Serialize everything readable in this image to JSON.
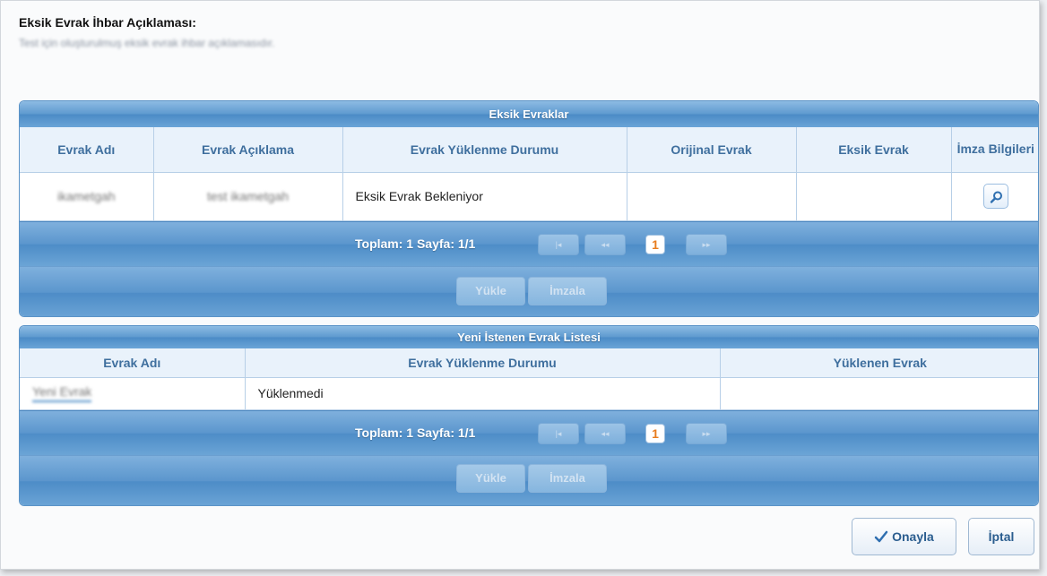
{
  "description": {
    "title": "Eksik Evrak İhbar Açıklaması:",
    "text": "Test için oluşturulmuş eksik evrak ihbar açıklamasıdır."
  },
  "missing_docs": {
    "title": "Eksik Evraklar",
    "columns": [
      "Evrak Adı",
      "Evrak Açıklama",
      "Evrak Yüklenme Durumu",
      "Orijinal Evrak",
      "Eksik Evrak",
      "İmza Bilgileri"
    ],
    "row": {
      "name": "ikametgah",
      "desc": "test ikametgah",
      "status": "Eksik Evrak Bekleniyor",
      "original": "",
      "missing": ""
    },
    "pager": {
      "text": "Toplam: 1 Sayfa: 1/1",
      "current_page": "1"
    },
    "upload_label": "Yükle",
    "sign_label": "İmzala"
  },
  "new_docs": {
    "title": "Yeni İstenen Evrak Listesi",
    "columns": [
      "Evrak Adı",
      "Evrak Yüklenme Durumu",
      "Yüklenen Evrak"
    ],
    "row": {
      "name": "Yeni Evrak",
      "status": "Yüklenmedi",
      "uploaded": ""
    },
    "pager": {
      "text": "Toplam: 1 Sayfa: 1/1",
      "current_page": "1"
    },
    "upload_label": "Yükle",
    "sign_label": "İmzala"
  },
  "footer": {
    "approve_label": "Onayla",
    "cancel_label": "İptal"
  },
  "icons": {
    "first": "first-page-icon",
    "prev": "prev-page-icon",
    "next": "next-page-icon",
    "search": "search-icon",
    "check": "check-icon"
  }
}
